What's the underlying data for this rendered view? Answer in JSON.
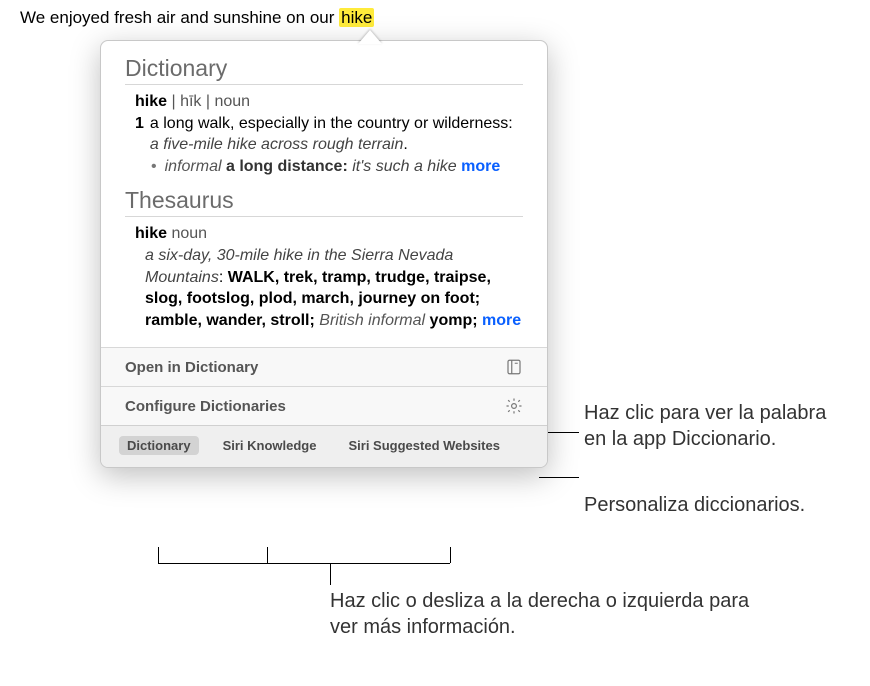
{
  "sentence": {
    "prefix": "We enjoyed fresh air and sunshine on our ",
    "word": "hike"
  },
  "dict": {
    "title": "Dictionary",
    "headword": "hike",
    "pronunciation": "| hīk |",
    "pos": "noun",
    "def_num": "1",
    "def_text": "a long walk, especially in the country or wilderness:",
    "def_example": "a five-mile hike across rough terrain",
    "sub_label": "informal",
    "sub_def": "a long distance:",
    "sub_example": "it's such a hike",
    "more": "more"
  },
  "thes": {
    "title": "Thesaurus",
    "headword": "hike",
    "pos": "noun",
    "example": "a six-day, 30-mile hike in the Sierra Nevada Mountains",
    "syn_lead": "WALK",
    "syns": ", trek, tramp, trudge, traipse, slog, footslog, plod, march, journey on foot; ramble, wander, stroll; ",
    "brit_label": "British informal",
    "brit_syn": " yomp; ",
    "more": "more"
  },
  "actions": {
    "open": "Open in Dictionary",
    "configure": "Configure Dictionaries"
  },
  "tabs": {
    "dictionary": "Dictionary",
    "siri_knowledge": "Siri Knowledge",
    "siri_websites": "Siri Suggested Websites"
  },
  "annotations": {
    "open_note": "Haz clic para ver la palabra en la app Diccionario.",
    "configure_note": "Personaliza diccionarios.",
    "tabs_note": "Haz clic o desliza a la derecha o izquierda para ver más información."
  }
}
